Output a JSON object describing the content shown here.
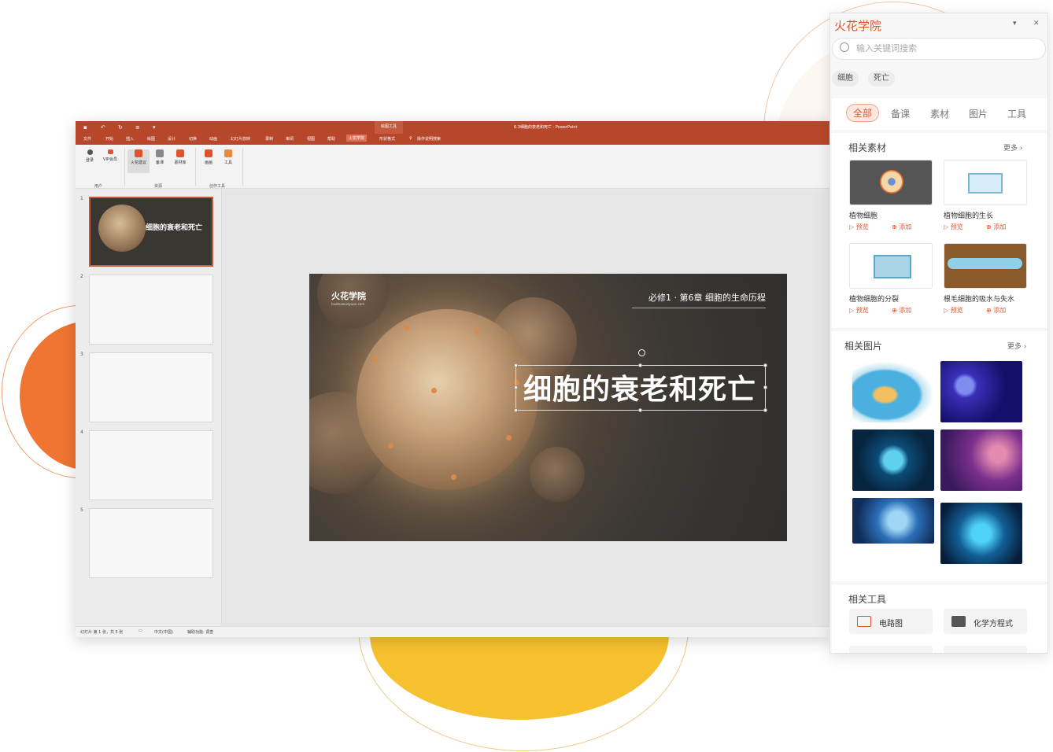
{
  "ppt": {
    "window_title": "6.3细胞的衰老和死亡 - PowerPoint",
    "context_tab_header": "绘图工具",
    "tabs": [
      "文件",
      "开始",
      "插入",
      "绘图",
      "设计",
      "切换",
      "动画",
      "幻灯片放映",
      "录制",
      "审阅",
      "视图",
      "帮助",
      "火花学院",
      "形状格式"
    ],
    "active_tab": "火花学院",
    "tell_me": "操作说明搜索",
    "ribbon": {
      "user_btn": "登录",
      "vip_btn": "VIP会员",
      "suggest_btn": "火花建议",
      "prep_btn": "备课",
      "material_btn": "素材库",
      "draw_btn": "画画",
      "tool_btn": "工具",
      "group_user": "用户",
      "group_resource": "资源",
      "group_create": "创作工具"
    },
    "slide_numbers": [
      "1",
      "2",
      "3",
      "4",
      "5"
    ],
    "thumb_title": "细胞的衰老和死亡",
    "status": {
      "slide_info": "幻灯片 第 1 张，共 5 张",
      "language": "中文(中国)",
      "accessibility": "辅助功能: 调查"
    },
    "slide": {
      "logo": "火花学院",
      "logo_sub": "huahuaxueyuan.com",
      "chapter": "必修1 · 第6章  细胞的生命历程",
      "title": "细胞的衰老和死亡"
    }
  },
  "panel": {
    "title": "火花学院",
    "search_placeholder": "输入关键词搜索",
    "tags": [
      "细胞",
      "死亡"
    ],
    "categories": [
      "全部",
      "备课",
      "素材",
      "图片",
      "工具"
    ],
    "active_category": "全部",
    "materials_title": "相关素材",
    "more": "更多",
    "preview": "预览",
    "add": "添加",
    "materials": [
      "植物细胞",
      "植物细胞的生长",
      "植物细胞的分裂",
      "根毛细胞的吸水与失水"
    ],
    "pictures_title": "相关图片",
    "tools_title": "相关工具",
    "tools": [
      "电路图",
      "化学方程式"
    ]
  }
}
